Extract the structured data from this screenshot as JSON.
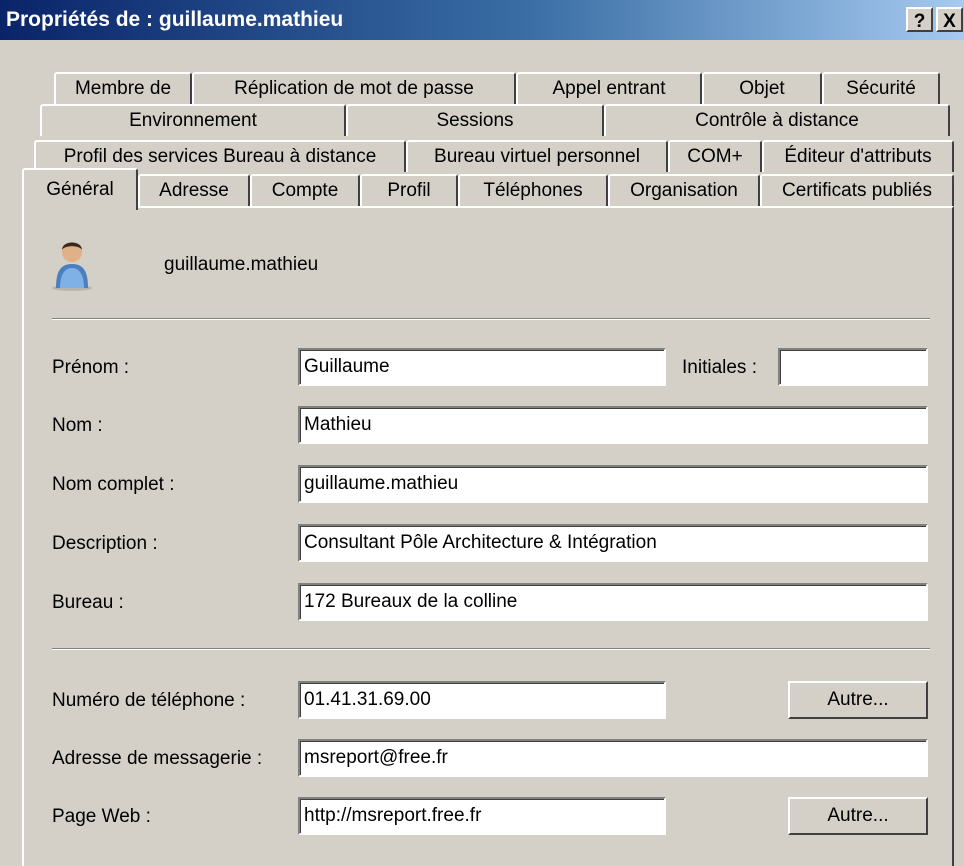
{
  "window": {
    "title": "Propriétés de : guillaume.mathieu",
    "help_label": "?",
    "close_label": "X"
  },
  "tabs": {
    "row1": [
      "Membre de",
      "Réplication de mot de passe",
      "Appel entrant",
      "Objet",
      "Sécurité"
    ],
    "row2": [
      "Environnement",
      "Sessions",
      "Contrôle à distance"
    ],
    "row3": [
      "Profil des services Bureau à distance",
      "Bureau virtuel personnel",
      "COM+",
      "Éditeur d'attributs"
    ],
    "row4": [
      "Général",
      "Adresse",
      "Compte",
      "Profil",
      "Téléphones",
      "Organisation",
      "Certificats publiés"
    ],
    "active": "Général"
  },
  "general": {
    "display_name": "guillaume.mathieu",
    "user_icon": "user-icon",
    "first_name": {
      "label": "Prénom :",
      "value": "Guillaume"
    },
    "initials": {
      "label": "Initiales :",
      "value": ""
    },
    "last_name": {
      "label": "Nom :",
      "value": "Mathieu"
    },
    "full_name": {
      "label": "Nom complet :",
      "value": "guillaume.mathieu"
    },
    "description": {
      "label": "Description :",
      "value": "Consultant Pôle Architecture & Intégration"
    },
    "office": {
      "label": "Bureau :",
      "value": "172 Bureaux de la colline"
    },
    "phone": {
      "label": "Numéro de téléphone :",
      "value": "01.41.31.69.00",
      "other_button": "Autre..."
    },
    "email": {
      "label": "Adresse de messagerie :",
      "value": "msreport@free.fr"
    },
    "web_page": {
      "label": "Page Web :",
      "value": "http://msreport.free.fr",
      "other_button": "Autre..."
    }
  }
}
